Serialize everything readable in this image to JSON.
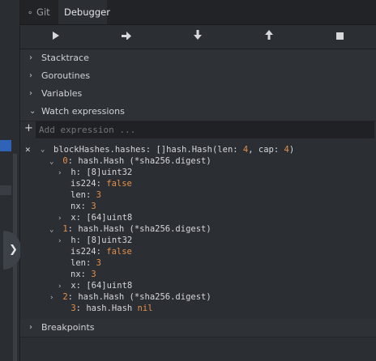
{
  "tabs": {
    "git": "Git",
    "debugger": "Debugger"
  },
  "controls": [
    "play-icon",
    "step-over-icon",
    "step-in-icon",
    "step-out-icon",
    "stop-icon"
  ],
  "sections": {
    "stacktrace": "Stacktrace",
    "goroutines": "Goroutines",
    "variables": "Variables",
    "watch": "Watch expressions",
    "breakpoints": "Breakpoints"
  },
  "add_expression": {
    "placeholder": "Add expression ..."
  },
  "watch": {
    "root": {
      "name": "blockHashes.hashes",
      "type": "[]hash.Hash(len: ",
      "len": "4",
      "cap_text": ", cap: ",
      "cap": "4",
      "close": ")"
    },
    "item0": {
      "index": "0",
      "type": "hash.Hash (*sha256.digest)"
    },
    "item0_h": {
      "name": "h",
      "type": "[8]uint32"
    },
    "item0_is224": {
      "name": "is224",
      "value": "false"
    },
    "item0_len": {
      "name": "len",
      "value": "3"
    },
    "item0_nx": {
      "name": "nx",
      "value": "3"
    },
    "item0_x": {
      "name": "x",
      "type": "[64]uint8"
    },
    "item1": {
      "index": "1",
      "type": "hash.Hash (*sha256.digest)"
    },
    "item1_h": {
      "name": "h",
      "type": "[8]uint32"
    },
    "item1_is224": {
      "name": "is224",
      "value": "false"
    },
    "item1_len": {
      "name": "len",
      "value": "3"
    },
    "item1_nx": {
      "name": "nx",
      "value": "3"
    },
    "item1_x": {
      "name": "x",
      "type": "[64]uint8"
    },
    "item2": {
      "index": "2",
      "type": "hash.Hash (*sha256.digest)"
    },
    "item3": {
      "index": "3",
      "type": "hash.Hash",
      "value": "nil"
    }
  }
}
